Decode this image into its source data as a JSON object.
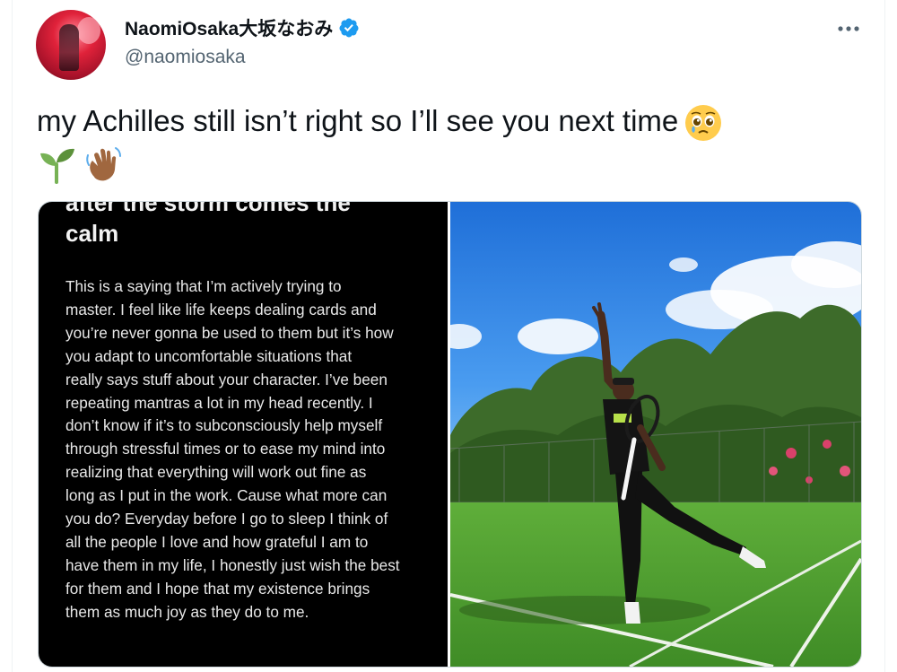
{
  "author": {
    "display_name": "NaomiOsaka大坂なおみ",
    "handle": "@naomiosaka",
    "verified": true,
    "avatar_icon": "avatar-photo"
  },
  "header": {
    "more_icon": "more-options-icon"
  },
  "tweet": {
    "text": "my Achilles still isn’t right so I’ll see you next time",
    "emojis_inline": [
      "pleading-face-emoji"
    ],
    "emojis_line2": [
      "seedling-emoji",
      "waving-hand-emoji"
    ]
  },
  "media": {
    "note_image": {
      "heading_cut": "after the storm comes the",
      "heading": "calm",
      "body": "This is a saying that I’m actively trying to\nmaster. I feel like life keeps dealing cards and\nyou’re never gonna be used to them but it’s how\nyou adapt to uncomfortable situations that\nreally says stuff about your character. I’ve been\nrepeating mantras a lot in my head recently. I\ndon’t know if it’s to subconsciously help myself\nthrough stressful times or to ease my mind into\nrealizing that everything will work out fine as\nlong as I put in the work. Cause what more can\nyou do? Everyday before I go to sleep I think of\nall the people I love and how grateful I am to\nhave them in my life, I honestly just wish the best\nfor them and I hope that my existence brings\nthem as much joy as they do to me."
    },
    "photo": {
      "icon": "tennis-court-photo"
    }
  },
  "colors": {
    "text_primary": "#0f1419",
    "text_secondary": "#536471",
    "verified_blue": "#1d9bf0",
    "border": "#cfd9de"
  }
}
